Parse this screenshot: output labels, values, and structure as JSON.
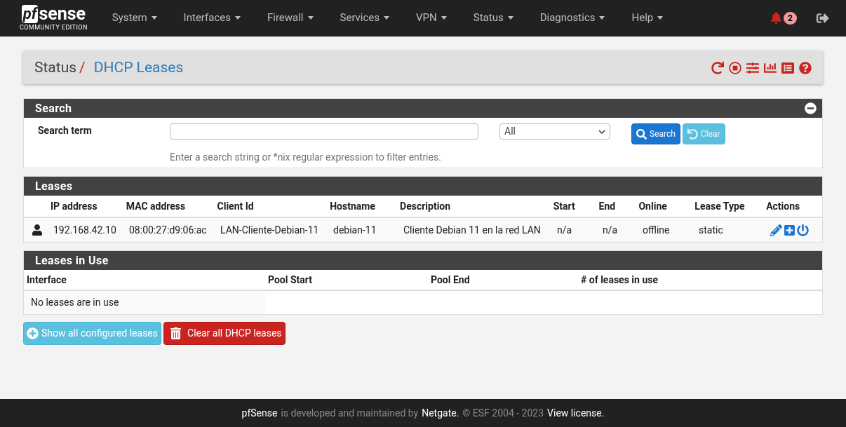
{
  "navbar": {
    "logo": {
      "mark": "pf",
      "word": "sense",
      "edition": "COMMUNITY EDITION"
    },
    "menus": [
      {
        "label": "System"
      },
      {
        "label": "Interfaces"
      },
      {
        "label": "Firewall"
      },
      {
        "label": "Services"
      },
      {
        "label": "VPN"
      },
      {
        "label": "Status"
      },
      {
        "label": "Diagnostics"
      },
      {
        "label": "Help"
      }
    ],
    "notifications": "2"
  },
  "breadcrumb": {
    "parent": "Status",
    "separator": "/",
    "current": "DHCP Leases"
  },
  "search_panel": {
    "title": "Search",
    "label": "Search term",
    "filter": "All",
    "search_button": "Search",
    "clear_button": "Clear",
    "hint": "Enter a search string or *nix regular expression to filter entries."
  },
  "leases": {
    "title": "Leases",
    "columns": [
      "IP address",
      "MAC address",
      "Client Id",
      "Hostname",
      "Description",
      "Start",
      "End",
      "Online",
      "Lease Type",
      "Actions"
    ],
    "rows": [
      {
        "ip": "192.168.42.10",
        "mac": "08:00:27:d9:06:ac",
        "client_id": "LAN-Cliente-Debian-11",
        "hostname": "debian-11",
        "description": "Cliente Debian 11 en la red LAN",
        "start": "n/a",
        "end": "n/a",
        "online": "offline",
        "lease_type": "static"
      }
    ]
  },
  "leases_in_use": {
    "title": "Leases in Use",
    "columns": [
      "Interface",
      "Pool Start",
      "Pool End",
      "# of leases in use"
    ],
    "empty_message": "No leases are in use"
  },
  "buttons": [
    {
      "kind": "info",
      "label": "Show all configured leases"
    },
    {
      "kind": "danger",
      "label": "Clear all DHCP leases"
    }
  ],
  "footer": {
    "brand": "pfSense",
    "text": "is developed and maintained by",
    "company": "Netgate.",
    "copyright": "© ESF 2004 - 2023",
    "license_link": "View license."
  }
}
